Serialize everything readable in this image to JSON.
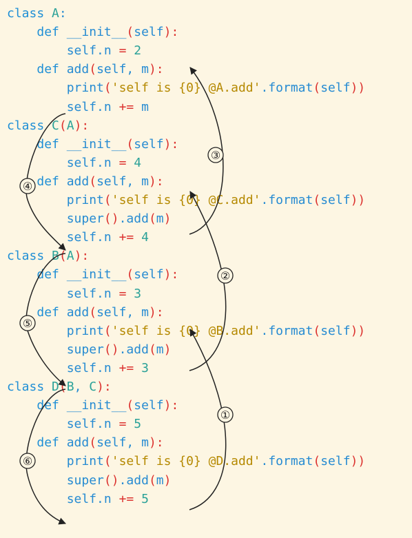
{
  "code_lines": [
    {
      "tokens": [
        [
          "kw",
          "class "
        ],
        [
          "cls",
          "A"
        ],
        [
          "plain",
          ":"
        ]
      ]
    },
    {
      "tokens": [
        [
          "plain",
          "    "
        ],
        [
          "kw",
          "def "
        ],
        [
          "fn",
          "__init__"
        ],
        [
          "paren",
          "("
        ],
        [
          "plain",
          "self"
        ],
        [
          "paren",
          "):"
        ]
      ]
    },
    {
      "tokens": [
        [
          "plain",
          "        self.n "
        ],
        [
          "op",
          "="
        ],
        [
          "plain",
          " "
        ],
        [
          "num",
          "2"
        ]
      ]
    },
    {
      "tokens": [
        [
          "plain",
          "    "
        ],
        [
          "kw",
          "def "
        ],
        [
          "fn",
          "add"
        ],
        [
          "paren",
          "("
        ],
        [
          "plain",
          "self, m"
        ],
        [
          "paren",
          "):"
        ]
      ]
    },
    {
      "tokens": [
        [
          "plain",
          "        "
        ],
        [
          "fn",
          "print"
        ],
        [
          "paren",
          "("
        ],
        [
          "str",
          "'self is {0} @A.add'"
        ],
        [
          "plain",
          "."
        ],
        [
          "fn",
          "format"
        ],
        [
          "paren",
          "("
        ],
        [
          "plain",
          "self"
        ],
        [
          "paren",
          "))"
        ]
      ]
    },
    {
      "tokens": [
        [
          "plain",
          "        self.n "
        ],
        [
          "op",
          "+="
        ],
        [
          "plain",
          " m"
        ]
      ]
    },
    {
      "tokens": [
        [
          "kw",
          "class "
        ],
        [
          "cls",
          "C"
        ],
        [
          "paren",
          "("
        ],
        [
          "cls",
          "A"
        ],
        [
          "paren",
          "):"
        ]
      ]
    },
    {
      "tokens": [
        [
          "plain",
          "    "
        ],
        [
          "kw",
          "def "
        ],
        [
          "fn",
          "__init__"
        ],
        [
          "paren",
          "("
        ],
        [
          "plain",
          "self"
        ],
        [
          "paren",
          "):"
        ]
      ]
    },
    {
      "tokens": [
        [
          "plain",
          "        self.n "
        ],
        [
          "op",
          "="
        ],
        [
          "plain",
          " "
        ],
        [
          "num",
          "4"
        ]
      ]
    },
    {
      "tokens": [
        [
          "plain",
          "    "
        ],
        [
          "kw",
          "def "
        ],
        [
          "fn",
          "add"
        ],
        [
          "paren",
          "("
        ],
        [
          "plain",
          "self, m"
        ],
        [
          "paren",
          "):"
        ]
      ]
    },
    {
      "tokens": [
        [
          "plain",
          "        "
        ],
        [
          "fn",
          "print"
        ],
        [
          "paren",
          "("
        ],
        [
          "str",
          "'self is {0} @C.add'"
        ],
        [
          "plain",
          "."
        ],
        [
          "fn",
          "format"
        ],
        [
          "paren",
          "("
        ],
        [
          "plain",
          "self"
        ],
        [
          "paren",
          "))"
        ]
      ]
    },
    {
      "tokens": [
        [
          "plain",
          "        "
        ],
        [
          "fn",
          "super"
        ],
        [
          "paren",
          "()"
        ],
        [
          "plain",
          ".add"
        ],
        [
          "paren",
          "("
        ],
        [
          "plain",
          "m"
        ],
        [
          "paren",
          ")"
        ]
      ]
    },
    {
      "tokens": [
        [
          "plain",
          "        self.n "
        ],
        [
          "op",
          "+="
        ],
        [
          "plain",
          " "
        ],
        [
          "num",
          "4"
        ]
      ]
    },
    {
      "tokens": [
        [
          "kw",
          "class "
        ],
        [
          "cls",
          "B"
        ],
        [
          "paren",
          "("
        ],
        [
          "cls",
          "A"
        ],
        [
          "paren",
          "):"
        ]
      ]
    },
    {
      "tokens": [
        [
          "plain",
          "    "
        ],
        [
          "kw",
          "def "
        ],
        [
          "fn",
          "__init__"
        ],
        [
          "paren",
          "("
        ],
        [
          "plain",
          "self"
        ],
        [
          "paren",
          "):"
        ]
      ]
    },
    {
      "tokens": [
        [
          "plain",
          "        self.n "
        ],
        [
          "op",
          "="
        ],
        [
          "plain",
          " "
        ],
        [
          "num",
          "3"
        ]
      ]
    },
    {
      "tokens": [
        [
          "plain",
          "    "
        ],
        [
          "kw",
          "def "
        ],
        [
          "fn",
          "add"
        ],
        [
          "paren",
          "("
        ],
        [
          "plain",
          "self, m"
        ],
        [
          "paren",
          "):"
        ]
      ]
    },
    {
      "tokens": [
        [
          "plain",
          "        "
        ],
        [
          "fn",
          "print"
        ],
        [
          "paren",
          "("
        ],
        [
          "str",
          "'self is {0} @B.add'"
        ],
        [
          "plain",
          "."
        ],
        [
          "fn",
          "format"
        ],
        [
          "paren",
          "("
        ],
        [
          "plain",
          "self"
        ],
        [
          "paren",
          "))"
        ]
      ]
    },
    {
      "tokens": [
        [
          "plain",
          "        "
        ],
        [
          "fn",
          "super"
        ],
        [
          "paren",
          "()"
        ],
        [
          "plain",
          ".add"
        ],
        [
          "paren",
          "("
        ],
        [
          "plain",
          "m"
        ],
        [
          "paren",
          ")"
        ]
      ]
    },
    {
      "tokens": [
        [
          "plain",
          "        self.n "
        ],
        [
          "op",
          "+="
        ],
        [
          "plain",
          " "
        ],
        [
          "num",
          "3"
        ]
      ]
    },
    {
      "tokens": [
        [
          "kw",
          "class "
        ],
        [
          "cls",
          "D"
        ],
        [
          "paren",
          "("
        ],
        [
          "cls",
          "B"
        ],
        [
          "plain",
          ", "
        ],
        [
          "cls",
          "C"
        ],
        [
          "paren",
          "):"
        ]
      ]
    },
    {
      "tokens": [
        [
          "plain",
          "    "
        ],
        [
          "kw",
          "def "
        ],
        [
          "fn",
          "__init__"
        ],
        [
          "paren",
          "("
        ],
        [
          "plain",
          "self"
        ],
        [
          "paren",
          "):"
        ]
      ]
    },
    {
      "tokens": [
        [
          "plain",
          "        self.n "
        ],
        [
          "op",
          "="
        ],
        [
          "plain",
          " "
        ],
        [
          "num",
          "5"
        ]
      ]
    },
    {
      "tokens": [
        [
          "plain",
          "    "
        ],
        [
          "kw",
          "def "
        ],
        [
          "fn",
          "add"
        ],
        [
          "paren",
          "("
        ],
        [
          "plain",
          "self, m"
        ],
        [
          "paren",
          "):"
        ]
      ]
    },
    {
      "tokens": [
        [
          "plain",
          "        "
        ],
        [
          "fn",
          "print"
        ],
        [
          "paren",
          "("
        ],
        [
          "str",
          "'self is {0} @D.add'"
        ],
        [
          "plain",
          "."
        ],
        [
          "fn",
          "format"
        ],
        [
          "paren",
          "("
        ],
        [
          "plain",
          "self"
        ],
        [
          "paren",
          "))"
        ]
      ]
    },
    {
      "tokens": [
        [
          "plain",
          "        "
        ],
        [
          "fn",
          "super"
        ],
        [
          "paren",
          "()"
        ],
        [
          "plain",
          ".add"
        ],
        [
          "paren",
          "("
        ],
        [
          "plain",
          "m"
        ],
        [
          "paren",
          ")"
        ]
      ]
    },
    {
      "tokens": [
        [
          "plain",
          "        self.n "
        ],
        [
          "op",
          "+="
        ],
        [
          "plain",
          " "
        ],
        [
          "num",
          "5"
        ]
      ]
    }
  ],
  "markers": [
    "①",
    "②",
    "③",
    "④",
    "⑤",
    "⑥"
  ]
}
